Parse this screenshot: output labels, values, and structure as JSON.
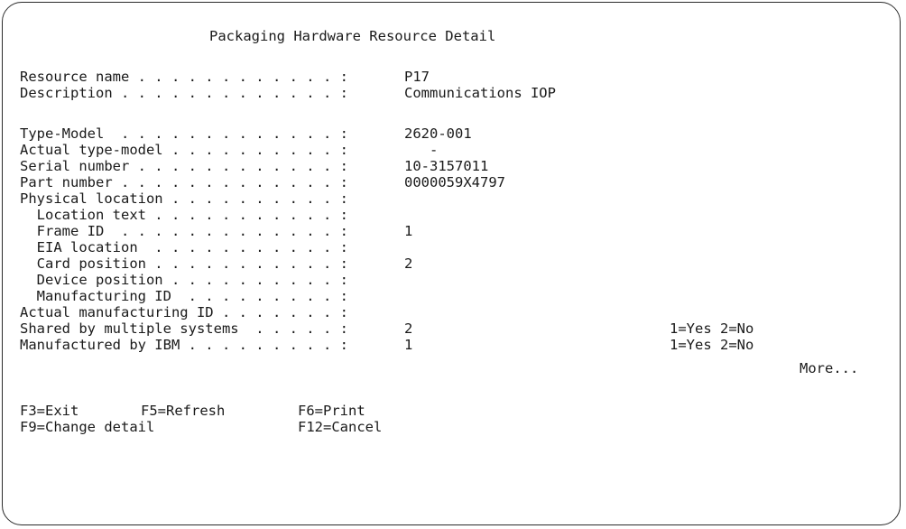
{
  "screen": {
    "title": "Packaging Hardware Resource Detail",
    "fields": [
      {
        "label": "Resource name . . . . . . . . . . . . :",
        "value": "P17",
        "hint": ""
      },
      {
        "label": "Description . . . . . . . . . . . . . :",
        "value": "Communications IOP",
        "hint": ""
      },
      {
        "label": "Type-Model  . . . . . . . . . . . . . :",
        "value": "2620-001",
        "hint": ""
      },
      {
        "label": "Actual type-model . . . . . . . . . . :",
        "value": "   -",
        "hint": ""
      },
      {
        "label": "Serial number . . . . . . . . . . . . :",
        "value": "10-3157011",
        "hint": ""
      },
      {
        "label": "Part number . . . . . . . . . . . . . :",
        "value": "0000059X4797",
        "hint": ""
      },
      {
        "label": "Physical location . . . . . . . . . . :",
        "value": "",
        "hint": ""
      },
      {
        "label": "  Location text . . . . . . . . . . . :",
        "value": "",
        "hint": ""
      },
      {
        "label": "  Frame ID  . . . . . . . . . . . . . :",
        "value": "1",
        "hint": ""
      },
      {
        "label": "  EIA location  . . . . . . . . . . . :",
        "value": "",
        "hint": ""
      },
      {
        "label": "  Card position . . . . . . . . . . . :",
        "value": "2",
        "hint": ""
      },
      {
        "label": "  Device position . . . . . . . . . . :",
        "value": "",
        "hint": ""
      },
      {
        "label": "  Manufacturing ID  . . . . . . . . . :",
        "value": "",
        "hint": ""
      },
      {
        "label": "Actual manufacturing ID . . . . . . . :",
        "value": "",
        "hint": ""
      },
      {
        "label": "Shared by multiple systems  . . . . . :",
        "value": "2",
        "hint": "1=Yes 2=No"
      },
      {
        "label": "Manufactured by IBM . . . . . . . . . :",
        "value": "1",
        "hint": "1=Yes 2=No"
      }
    ],
    "more_indicator": "More...",
    "function_keys": {
      "row1": [
        "F3=Exit",
        "F5=Refresh",
        "F6=Print"
      ],
      "row2": [
        "F9=Change detail",
        "F12=Cancel"
      ]
    }
  }
}
